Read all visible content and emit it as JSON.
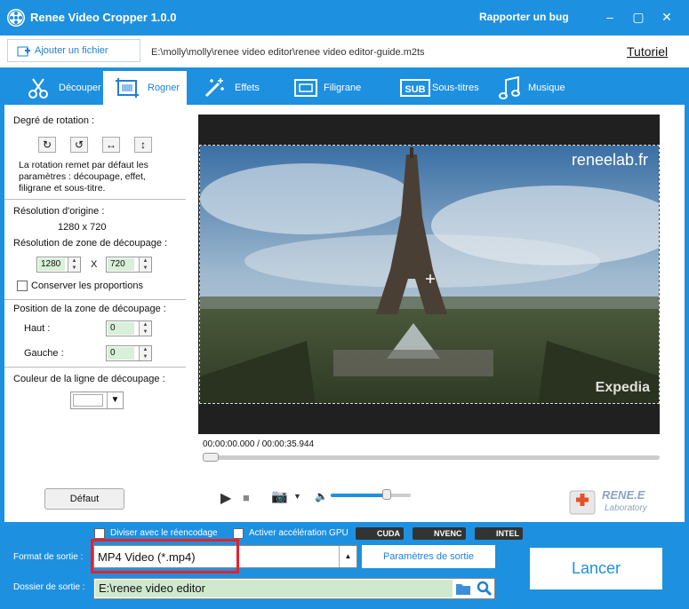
{
  "app": {
    "title": "Renee Video Cropper 1.0.0",
    "bug": "Rapporter un bug",
    "minimize": "–",
    "restore": "▢",
    "close": "✕"
  },
  "filebar": {
    "add_file": "Ajouter un fichier",
    "path": "E:\\molly\\molly\\renee video editor\\renee video editor-guide.m2ts",
    "tutoriel": "Tutoriel"
  },
  "tabs": [
    "Découper",
    "Rogner",
    "Effets",
    "Filigrane",
    "Sous-titres",
    "Musique"
  ],
  "left": {
    "rotation_title": "Degré de rotation :",
    "rotation_note": "La rotation remet par défaut les paramètres : découpage, effet, filigrane et sous-titre.",
    "orig_res_label": "Résolution d'origine :",
    "orig_res": "1280 x 720",
    "crop_res_label": "Résolution de zone de découpage :",
    "crop_w": "1280",
    "crop_x": "X",
    "crop_h": "720",
    "keep_ratio": "Conserver les proportions",
    "pos_title": "Position de la zone de découpage :",
    "top_label": "Haut :",
    "top_val": "0",
    "left_label": "Gauche :",
    "left_val": "0",
    "color_title": "Couleur de la ligne de découpage :",
    "default_btn": "Défaut"
  },
  "player": {
    "watermark": "reneelab.fr",
    "expedia": "Expedia",
    "time": "00:00:00.000 / 00:00:35.944",
    "play": "▶",
    "stop": "■",
    "camera": "📷",
    "vol": "🔈",
    "volume": 0.7,
    "progress": 0.0
  },
  "brand": {
    "line1": "RENE.E",
    "line2": "Laboratory"
  },
  "bottom": {
    "split": "Diviser avec le réencodage",
    "gpu": "Activer accélération GPU",
    "badges": [
      "CUDA",
      "NVENC",
      "INTEL"
    ],
    "format_label": "Format de sortie :",
    "format_value": "MP4 Video (*.mp4)",
    "params_btn": "Paramètres de sortie",
    "folder_label": "Dossier de sortie :",
    "folder_value": "E:\\renee video editor",
    "launch": "Lancer"
  },
  "colors": {
    "accent": "#1e90e0",
    "highlight": "#e8202a"
  }
}
